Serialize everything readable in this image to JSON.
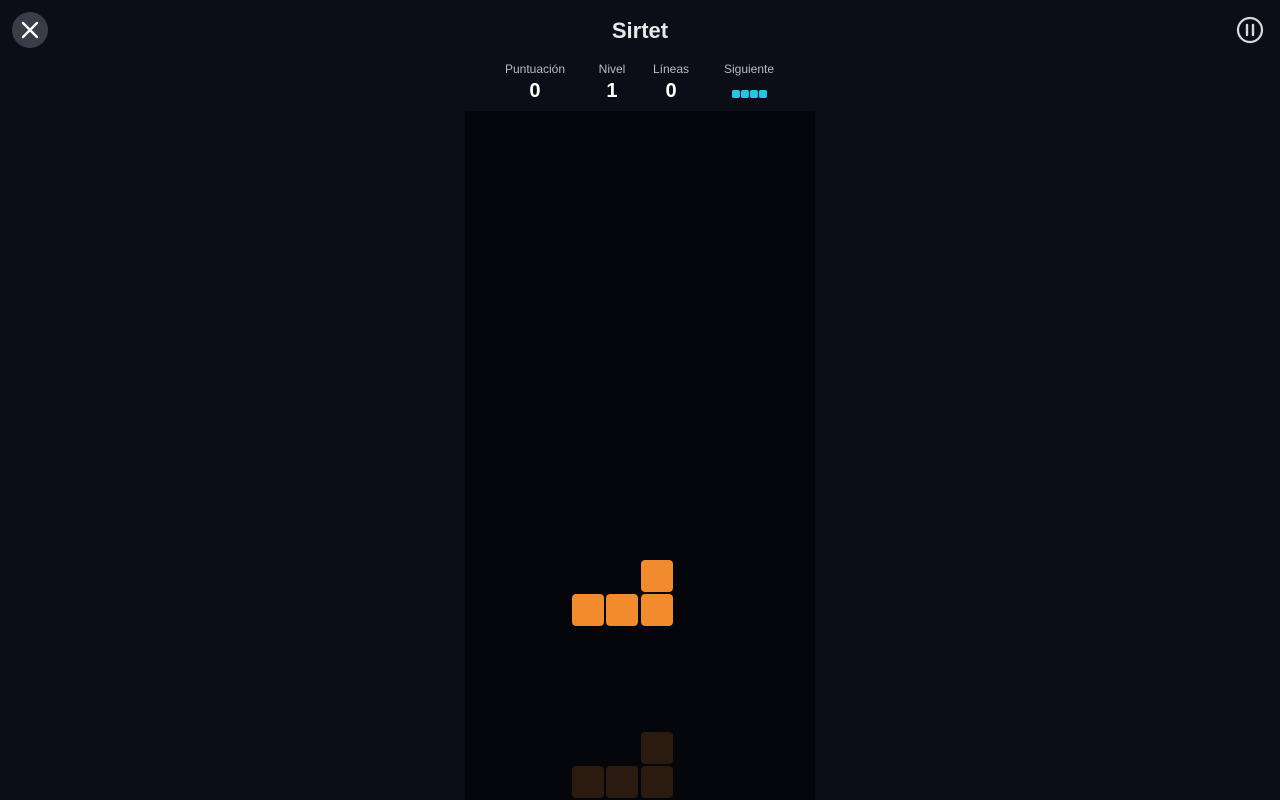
{
  "header": {
    "title": "Sirtet",
    "close_icon": "close-icon",
    "pause_icon": "pause-icon"
  },
  "stats": {
    "score_label": "Puntuación",
    "score_value": "0",
    "level_label": "Nivel",
    "level_value": "1",
    "lines_label": "Líneas",
    "lines_value": "0",
    "next_label": "Siguiente",
    "next_piece": "I",
    "next_color": "#22c7e6"
  },
  "board": {
    "background": "#05060b",
    "active_piece": {
      "type": "L",
      "color": "#f28a2e"
    },
    "ghost_piece": {
      "type": "L",
      "color": "#2a1a10"
    }
  },
  "colors": {
    "page_background": "#0b0d17",
    "close_button_bg": "#3a3d47"
  }
}
